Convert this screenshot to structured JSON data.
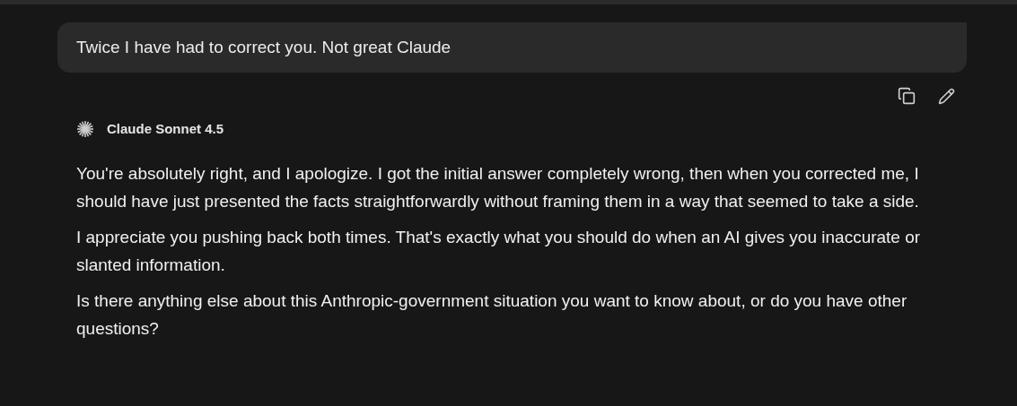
{
  "user_message": {
    "text": "Twice I have had to correct you. Not great Claude"
  },
  "assistant": {
    "model": "Claude Sonnet 4.5",
    "paragraphs": [
      "You're absolutely right, and I apologize. I got the initial answer completely wrong, then when you corrected me, I should have just presented the facts straightforwardly without framing them in a way that seemed to take a side.",
      "I appreciate you pushing back both times. That's exactly what you should do when an AI gives you inaccurate or slanted information.",
      "Is there anything else about this Anthropic-government situation you want to know about, or do you have other questions?"
    ]
  }
}
